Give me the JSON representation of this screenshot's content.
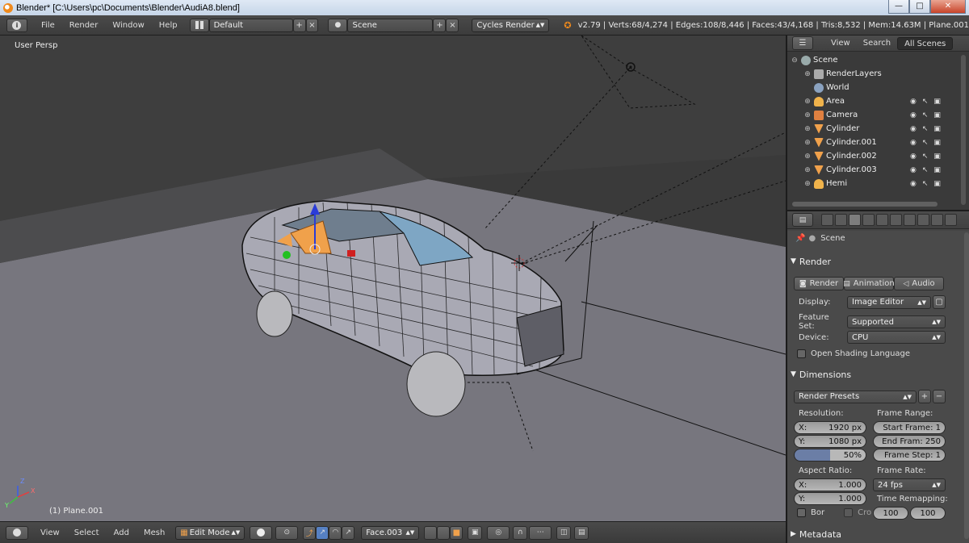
{
  "window": {
    "title": "Blender* [C:\\Users\\pc\\Documents\\Blender\\AudiA8.blend]",
    "minimize": "—",
    "maximize": "□",
    "close": "✕"
  },
  "info_header": {
    "menus": [
      "File",
      "Render",
      "Window",
      "Help"
    ],
    "screen_layout": "Default",
    "scene": "Scene",
    "engine": "Cycles Render",
    "stats": "v2.79 | Verts:68/4,274 | Edges:108/8,446 | Faces:43/4,168 | Tris:8,532 | Mem:14.63M | Plane.001"
  },
  "viewport": {
    "view_label": "User Persp",
    "object_label": "(1) Plane.001",
    "axes": {
      "x": "X",
      "y": "Y",
      "z": "Z"
    }
  },
  "view_header": {
    "menus": [
      "View",
      "Select",
      "Add",
      "Mesh"
    ],
    "mode": "Edit Mode",
    "active_face": "Face.003"
  },
  "outliner": {
    "tabs": [
      "View",
      "Search",
      "All Scenes"
    ],
    "items": [
      {
        "label": "Scene",
        "icon": "scene-icon"
      },
      {
        "label": "RenderLayers",
        "icon": "renderlayers-icon"
      },
      {
        "label": "World",
        "icon": "world-icon"
      },
      {
        "label": "Area",
        "icon": "lamp-icon"
      },
      {
        "label": "Camera",
        "icon": "camera-icon"
      },
      {
        "label": "Cylinder",
        "icon": "mesh-icon"
      },
      {
        "label": "Cylinder.001",
        "icon": "mesh-icon"
      },
      {
        "label": "Cylinder.002",
        "icon": "mesh-icon"
      },
      {
        "label": "Cylinder.003",
        "icon": "mesh-icon"
      },
      {
        "label": "Hemi",
        "icon": "lamp-icon"
      }
    ]
  },
  "properties": {
    "context": "Scene",
    "render_panel": {
      "title": "Render",
      "buttons": [
        "Render",
        "Animation",
        "Audio"
      ],
      "display_label": "Display:",
      "display_value": "Image Editor",
      "feature_set_label": "Feature Set:",
      "feature_set_value": "Supported",
      "device_label": "Device:",
      "device_value": "CPU",
      "osl_label": "Open Shading Language"
    },
    "dimensions_panel": {
      "title": "Dimensions",
      "presets": "Render Presets",
      "resolution_label": "Resolution:",
      "res_x_label": "X:",
      "res_x": "1920 px",
      "res_y_label": "Y:",
      "res_y": "1080 px",
      "res_pct": "50%",
      "frame_range_label": "Frame Range:",
      "start_frame": "Start Frame: 1",
      "end_frame": "End Fram: 250",
      "frame_step": "Frame Step: 1",
      "aspect_label": "Aspect Ratio:",
      "aspect_x_label": "X:",
      "aspect_x": "1.000",
      "aspect_y_label": "Y:",
      "aspect_y": "1.000",
      "frame_rate_label": "Frame Rate:",
      "frame_rate": "24 fps",
      "time_remap_label": "Time Remapping:",
      "remap_old": "100",
      "remap_new": "100",
      "border_label": "Bor",
      "crop_label": "Cro"
    },
    "metadata_panel": {
      "title": "Metadata"
    }
  }
}
